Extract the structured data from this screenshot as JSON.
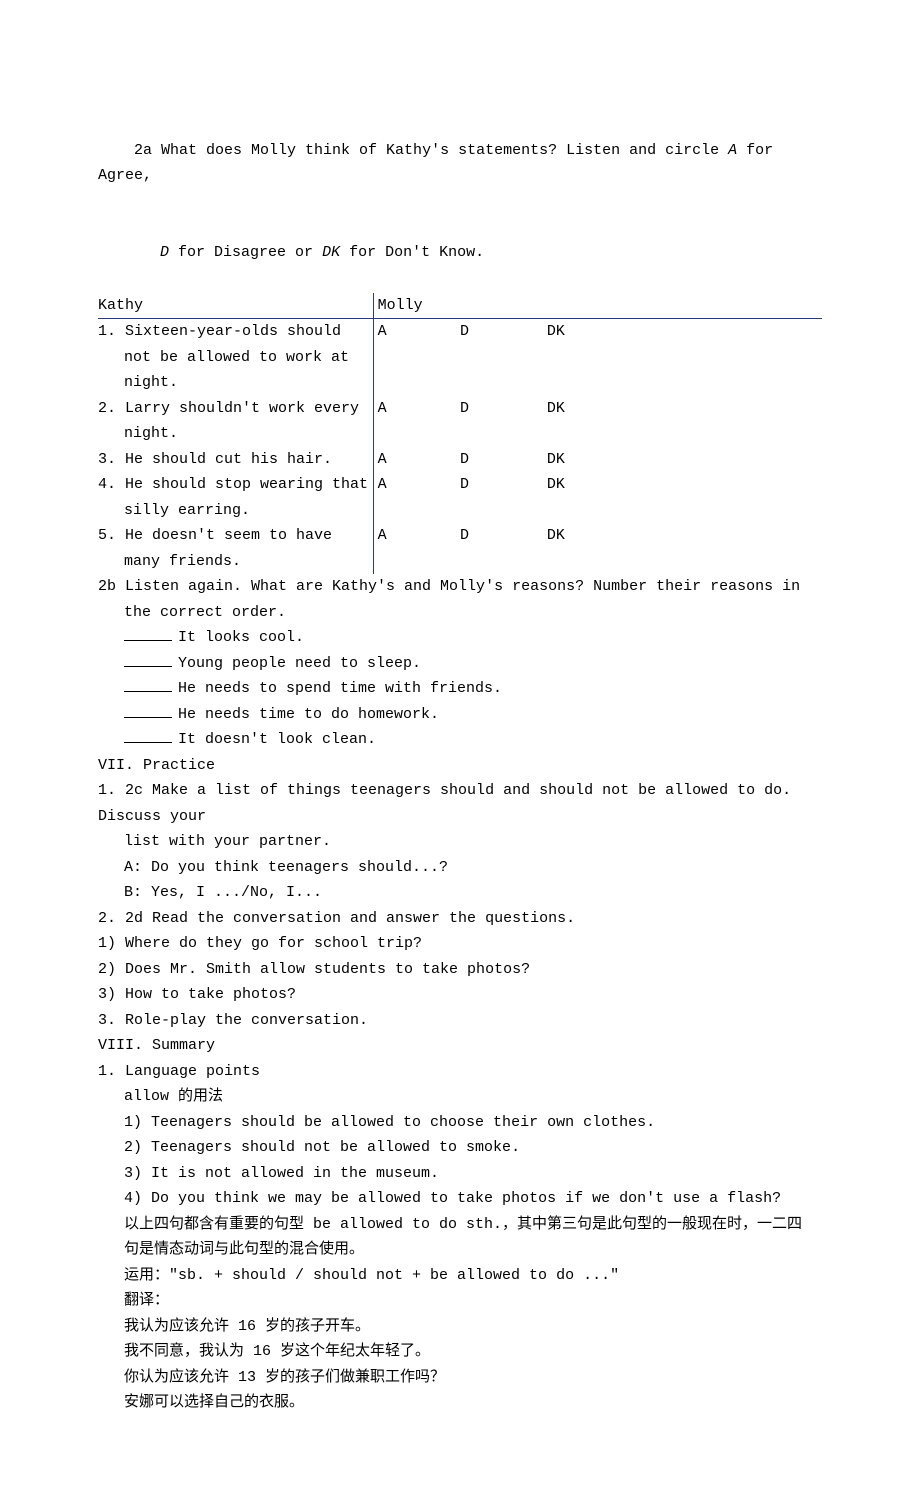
{
  "section2a": {
    "intro_l1": "2a What does Molly think of Kathy's statements? Listen and circle ",
    "intro_A": "A",
    "intro_mid1": " for Agree,",
    "intro_l2_pre": "",
    "intro_D": "D",
    "intro_mid2": " for Disagree or ",
    "intro_DK": "DK",
    "intro_end": " for Don't Know.",
    "col_kathy": "Kathy",
    "col_molly": "Molly",
    "rows": [
      {
        "text": "1. Sixteen-year-olds should not be allowed to work at night.",
        "a": "A",
        "d": "D",
        "dk": "DK"
      },
      {
        "text": "2. Larry shouldn't work every night.",
        "a": "A",
        "d": "D",
        "dk": "DK"
      },
      {
        "text": "3. He should cut his hair.",
        "a": "A",
        "d": "D",
        "dk": "DK"
      },
      {
        "text": "4. He should stop wearing that silly earring.",
        "a": "A",
        "d": "D",
        "dk": "DK"
      },
      {
        "text": "5. He doesn't seem to have many friends.",
        "a": "A",
        "d": "D",
        "dk": "DK"
      }
    ]
  },
  "section2b": {
    "intro_l1": "2b Listen again. What are Kathy's and Molly's reasons? Number their reasons in",
    "intro_l2": "the correct order.",
    "items": [
      "It looks cool.",
      "Young people need to sleep.",
      "He needs to spend time with friends.",
      "He needs time to do homework.",
      "It doesn't look clean."
    ]
  },
  "practice": {
    "heading": "VII. Practice",
    "p1_l1": "1. 2c Make a list of things teenagers should and should not be allowed to do. Discuss your",
    "p1_l2": "list with your partner.",
    "p1_a": "A: Do you think teenagers should...?",
    "p1_b": "B: Yes, I .../No, I...",
    "p2": "2. 2d Read the conversation and answer the questions.",
    "q1": "1) Where do they go for school trip?",
    "q2": "2) Does Mr. Smith allow students to take photos?",
    "q3": "3) How to take photos?",
    "p3": "3. Role-play the conversation."
  },
  "summary": {
    "heading": "VIII. Summary",
    "lp_heading": "1. Language points",
    "allow_heading": "allow 的用法",
    "ex1": "1) Teenagers should be allowed to choose their own clothes.",
    "ex2": "2) Teenagers should not be allowed to smoke.",
    "ex3": "3) It is not allowed in the museum.",
    "ex4": "4) Do you think we may be allowed to take photos if we don't use a flash?",
    "note_l1": "以上四句都含有重要的句型 be allowed to do sth.，其中第三句是此句型的一般现在时，一二四",
    "note_l2": "句是情态动词与此句型的混合使用。",
    "usage": "运用：\"sb. + should / should not + be allowed to do ...\"",
    "translate_heading": "翻译：",
    "t1": "我认为应该允许 16 岁的孩子开车。",
    "t2": "我不同意，我认为 16 岁这个年纪太年轻了。",
    "t3": "你认为应该允许 13 岁的孩子们做兼职工作吗？",
    "t4": "安娜可以选择自己的衣服。"
  }
}
